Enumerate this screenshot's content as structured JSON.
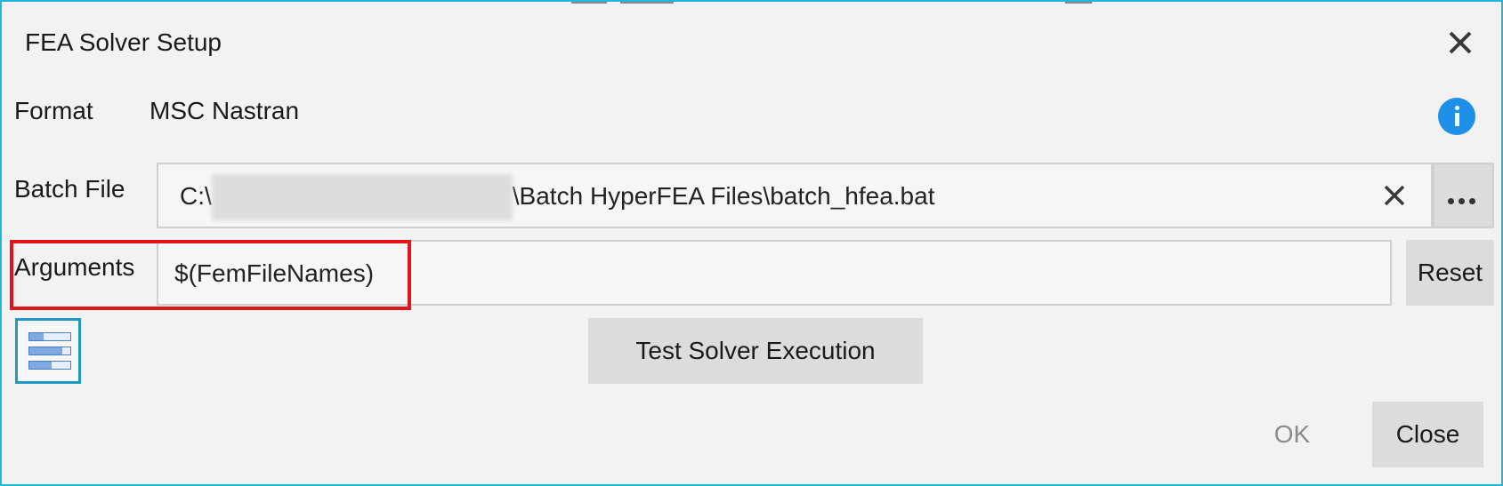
{
  "dialog": {
    "title": "FEA Solver Setup",
    "close_icon": "close-icon"
  },
  "format": {
    "label": "Format",
    "value": "MSC Nastran",
    "info_icon": "info-icon"
  },
  "batch_file": {
    "label": "Batch File",
    "value_prefix": "C:\\",
    "value_suffix": "\\Batch HyperFEA Files\\batch_hfea.bat",
    "clear_icon": "close-icon",
    "browse_icon": "more-icon"
  },
  "arguments": {
    "label": "Arguments",
    "value": "$(FemFileNames)",
    "reset_label": "Reset"
  },
  "toolbar": {
    "list_icon": "list-icon",
    "test_label": "Test Solver Execution"
  },
  "footer": {
    "ok_label": "OK",
    "close_label": "Close"
  },
  "colors": {
    "accent": "#20b8d8",
    "highlight": "#e0141b",
    "info": "#1e90e8"
  }
}
